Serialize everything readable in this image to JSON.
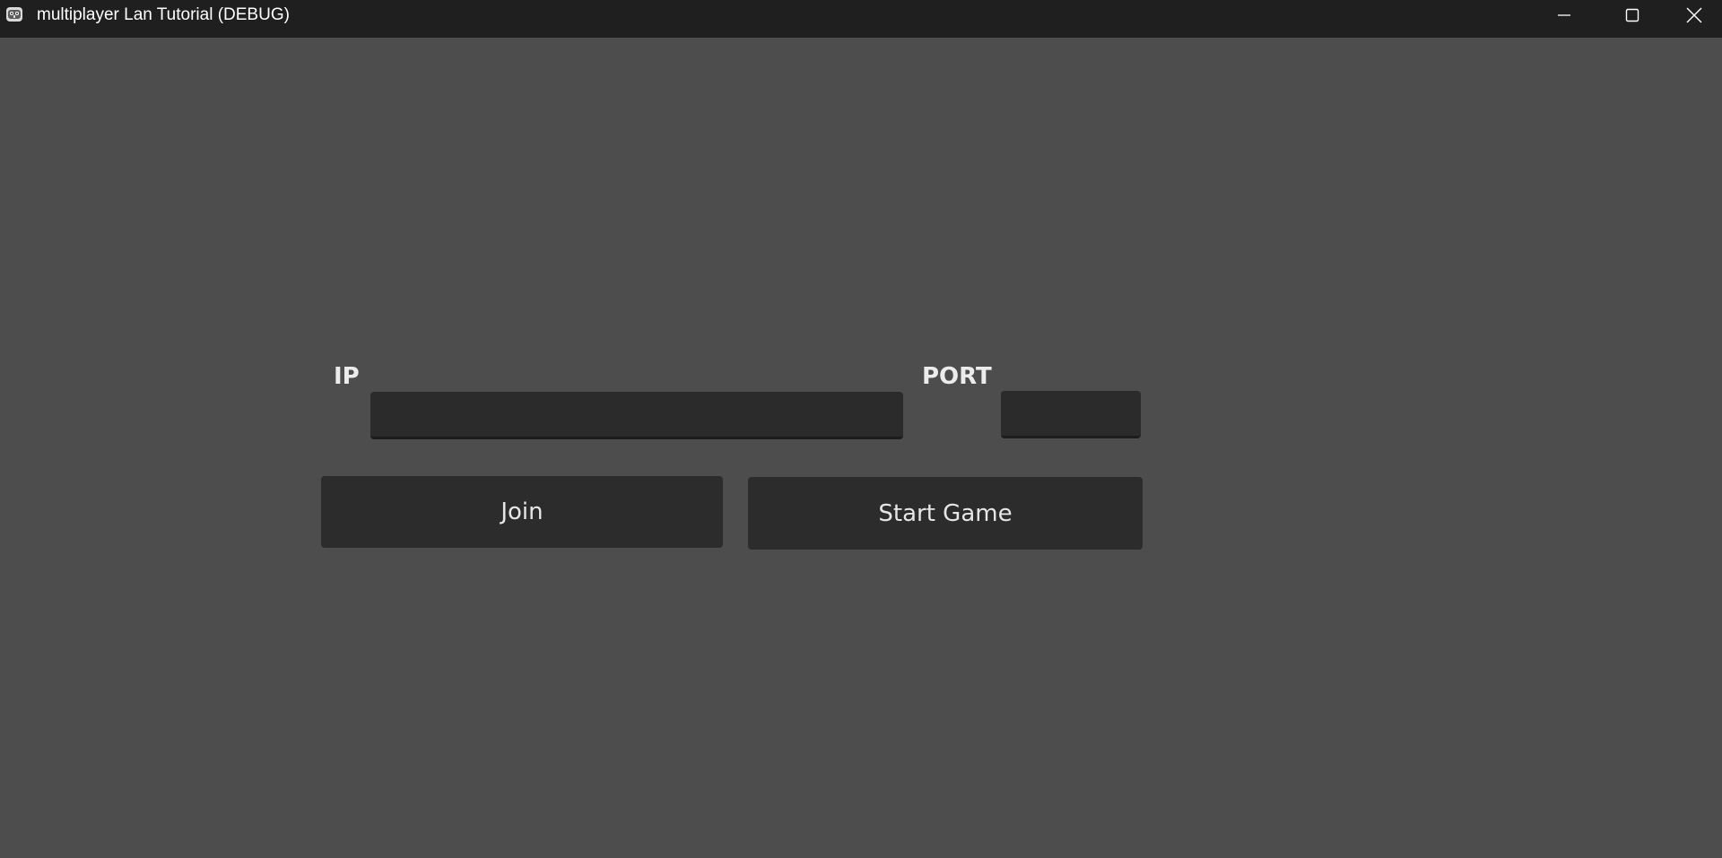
{
  "window": {
    "title": "multiplayer Lan Tutorial (DEBUG)",
    "icons": {
      "app": "godot-app-icon",
      "minimize": "minimize-icon",
      "maximize": "maximize-icon",
      "close": "close-icon"
    }
  },
  "form": {
    "ip_label": "IP",
    "ip_value": "",
    "port_label": "PORT",
    "port_value": ""
  },
  "buttons": {
    "join_label": "Join",
    "start_game_label": "Start Game"
  },
  "colors": {
    "titlebar": "#1f1f1f",
    "background": "#4d4d4d",
    "control": "#2b2b2b",
    "text": "#ececec"
  }
}
